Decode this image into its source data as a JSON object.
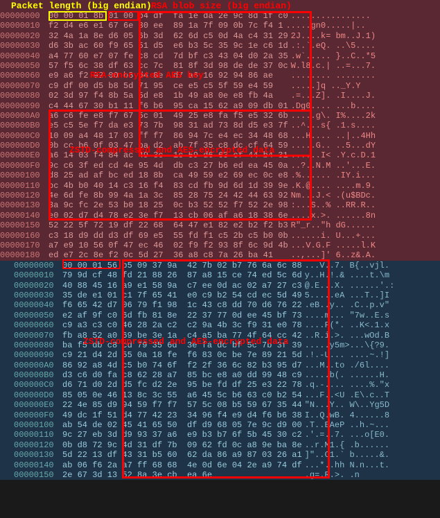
{
  "labels": {
    "packet_length": "Packet length (big endian)",
    "rsa_blob_size": "RSA blob size (big endian)",
    "rsa_encrypted_aes": "RSA-encrypted AES key",
    "zstd_aes_1": "ZSTD-compressed and AES-encrypted data",
    "zstd_aes_2": "ZSTD-compressed and AES-encrypted data"
  },
  "pink_rows": [
    {
      "offset": "00000000",
      "hex": "00 00 01 8b 01 00 b4 df  fa 1e da 2e 9c 8d 1f c0",
      "ascii": "................"
    },
    {
      "offset": "00000010",
      "hex": "f2 d4 e6 e1 67 6e 30 ee  89 1a 7f 09 0b 7c f4 1",
      "ascii": ".....gn0.....|.."
    },
    {
      "offset": "00000020",
      "hex": "32 4a 1a 8e d6 05 6b 3d  62 6d c5 0d 4a c4 31 29",
      "ascii": "2J....k= bm..J.1)"
    },
    {
      "offset": "00000030",
      "hex": "d6 3b ac 60 f9 65 51 d5  e6 b3 5c 35 9c 1e c6 1d",
      "ascii": ".:.`.eQ. ..\\5...."
    },
    {
      "offset": "00000040",
      "hex": "a4 77 60 e7 07 fe c8 cd  7d bf c3 43 04 d0 2a 35",
      "ascii": ".w`..... }..C..*5"
    },
    {
      "offset": "00000050",
      "hex": "57 f5 6c 38 df 63 cc 7c  81 8f 3d 98 de de 37 0c",
      "ascii": "W.l8.c.| ..=...7."
    },
    {
      "offset": "00000060",
      "hex": "e9 a6 f2 92 00 b8 d4 8e  d7 a6 16 92 94 86 ae   ",
      "ascii": "........ ........"
    },
    {
      "offset": "00000070",
      "hex": "c9 df 00 d5 b8 5d 71 95  ce e5 c5 5f 59 e4 59   ",
      "ascii": ".....]q .._Y.Y"
    },
    {
      "offset": "00000080",
      "hex": "02 3d 97 f4 8b 5a 5d e8  1b 49 a8 0e e8 fb 4a   ",
      "ascii": ".=...Z]. .I....J."
    },
    {
      "offset": "00000090",
      "hex": "c4 44 67 30 b1 11 f6 b6  95 ca 15 62 a9 09 db 01",
      "ascii": ".Dg0.... ...b...."
    },
    {
      "offset": "000000A0",
      "hex": "a6 c6 fe e8 f7 67 5c 01  49 25 e8 fa f5 e5 32 6b",
      "ascii": ".....g\\. I%....2k"
    },
    {
      "offset": "000000B0",
      "hex": "e5 c5 5e f7 da e3 73 7b  98 31 ad 73 8d d5 e3 7f",
      "ascii": "..^...s{ .1.s...."
    },
    {
      "offset": "000000C0",
      "hex": "10 09 a4 48 17 03 ff f7  86 94 7c e4 ec 34 48 68",
      "ascii": "...H.... ..|..4Hh"
    },
    {
      "offset": "000000D0",
      "hex": "0b cc b6 0f 03 47 ba d2  ab 7f 35 c8 dc cf 64 59",
      "ascii": ".....G.. ..5...dY"
    },
    {
      "offset": "000000E0",
      "hex": "a6 14 03 f4 84 ac 49 3c  1c 59 d6 63 cf 44 b4 31",
      "ascii": "......I< .Y.c.D.1"
    },
    {
      "offset": "000000F0",
      "hex": "9c c6 3f ed cd 4e 95 4d  db c3 27 b6 ed ea 45 0a",
      "ascii": "..?..N.M ..'...E."
    },
    {
      "offset": "00000100",
      "hex": "d8 25 ad af bc ed 18 8b  ca 49 59 e2 69 ec 0c e8",
      "ascii": ".%...... .IY.i..."
    },
    {
      "offset": "00000110",
      "hex": "bc 4b b0 40 14 c3 16 f4  83 cd fb 9d 6d 1d 39 9e",
      "ascii": ".K.@.... ....m.9."
    },
    {
      "offset": "00000120",
      "hex": "4e 6d fe 8b 99 4a 1a 3c  85 28 75 24 42 44 63 92",
      "ascii": "Nm...J.< .(u$BDc."
    },
    {
      "offset": "00000130",
      "hex": "3a 9c fc 2e 53 b0 18 25  0c b3 52 52 f7 52 2e 98",
      "ascii": ":...S..% ..RR.R.."
    },
    {
      "offset": "00000140",
      "hex": "e0 02 d7 d4 78 e2 3e f7  13 cb 06 af a6 18 38 6e",
      "ascii": "....x.>. ......8n"
    },
    {
      "offset": "00000150",
      "hex": "52 22 5f 72 19 df 22 68  64 47 e1 82 e2 b2 f2 b3",
      "ascii": "R\"_r..\"h dG......"
    },
    {
      "offset": "00000160",
      "hex": "c3 18 d9 dd d3 df 69 e5  55 fd f1 c5 2b c5 b0 0b",
      "ascii": "......i. U...+..."
    },
    {
      "offset": "00000170",
      "hex": "a7 e9 10 56 0f 47 ec 46  02 f9 f2 93 8f 6c 9d 4b",
      "ascii": "...V.G.F .....l.K"
    },
    {
      "offset": "00000180",
      "hex": "ed e7 2c 8e f2 0c 5d 27  36 a8 c8 7a 26 ba 41   ",
      "ascii": "..,...]' 6..z&.A."
    }
  ],
  "blue_rows": [
    {
      "offset": "00000000",
      "hex": "00 00 01 56 b5 09 37 9a  42 7b 02 b7 76 6a 6c 88",
      "ascii": "...V..7. B{..vjl."
    },
    {
      "offset": "00000010",
      "hex": "79 9d cf 48 fd 21 88 26  87 a8 15 ce 74 ed 5c 6d",
      "ascii": "y..H.!.& ....t.\\m"
    },
    {
      "offset": "00000020",
      "hex": "40 88 45 16 a9 e1 58 9a  c7 ee 0d ac 02 a7 27 c3",
      "ascii": "@.E...X. ......'.:"
    },
    {
      "offset": "00000030",
      "hex": "35 de e1 01 c1 7f 65 41  e0 c9 b2 54 cd ec 5d 49",
      "ascii": "5.....eA ...T..]I"
    },
    {
      "offset": "00000040",
      "hex": "f6 65 42 d7 06 79 f1 98  1c 43 c8 dd 70 d6 76 22",
      "ascii": ".eB..y.. .C..p.v\""
    },
    {
      "offset": "00000050",
      "hex": "e2 af 9f c0 6d fb 81 8e  22 37 77 0d ee 45 bf 73",
      "ascii": "....m... \"7w..E.s"
    },
    {
      "offset": "00000060",
      "hex": "c9 a3 c3 c0 46 28 2a c2  c2 9a 4b 3c f9 31 e0 78",
      "ascii": "....F(*. ..K<.1.x"
    },
    {
      "offset": "00000070",
      "hex": "fb a8 52 a0 69 be 3e 1a  c4 a5 ba 77 4f 64 cc 42",
      "ascii": "..R.i.>. ...wOd.B"
    },
    {
      "offset": "00000080",
      "hex": "ba f5 db c8 cd 79 35 6d  3e fa dc bf 5c 7b 3f 39",
      "ascii": ".....y5m>...\\{?9."
    },
    {
      "offset": "00000090",
      "hex": "c9 21 d4 2d 55 0a 18 fe  f6 83 0c be 7e 89 21 5d",
      "ascii": ".!.-U... ....~.!]"
    },
    {
      "offset": "000000A0",
      "hex": "86 92 a8 4d c5 b0 74 6f  f2 2f 36 6c 82 b3 95 d7",
      "ascii": "...M..to ./6l...."
    },
    {
      "offset": "000000B0",
      "hex": "d3 c6 d0 fa c8 62 28 a7  85 bc e8 a0 dd 99 48 c9",
      "ascii": ".....b(. ......H."
    },
    {
      "offset": "000000C0",
      "hex": "d6 71 d0 2d d5 fc d2 2e  95 be fd df 25 e3 22 78",
      "ascii": ".q.-.... ....%.\"x"
    },
    {
      "offset": "000000D0",
      "hex": "85 05 0e 46 13 8c 3c 55  a6 45 5c b6 63 c0 b2 54",
      "ascii": "...F..<U .E\\.c..T"
    },
    {
      "offset": "000000E0",
      "hex": "22 4e 85 d9 94 59 f7 f7  57 5c 08 b5 59 67 35 44",
      "ascii": "\"N...Y.. W\\..Yg5D"
    },
    {
      "offset": "000000F0",
      "hex": "49 dc 1f 51 d4 77 42 23  34 96 f4 e9 d4 f6 b6 38",
      "ascii": "I..Q.wB. 4......8"
    },
    {
      "offset": "00000100",
      "hex": "ab 54 de 02 45 41 65 50  df d9 68 05 7e 9c d9 00",
      "ascii": ".T..EAeP ..h.~..."
    },
    {
      "offset": "00000110",
      "hex": "9c 27 eb 3d d9 93 37 a6  e9 b3 b7 6f 5b 45 30 c2",
      "ascii": ".'.=..7. ...o[E0."
    },
    {
      "offset": "00000120",
      "hex": "0b d8 72 9c 4d 31 df 7b  09 62 fd 0c a8 9e ba 8e",
      "ascii": "..r.M1.{ .b......"
    },
    {
      "offset": "00000130",
      "hex": "5d 22 13 df 43 31 b5 60  62 da 86 a9 87 03 26 a1",
      "ascii": "]\"..C1.` b.....&."
    },
    {
      "offset": "00000140",
      "hex": "ab 06 f6 2a a7 ff 68 68  4e 0d 6e 04 2e a9 74 df",
      "ascii": "...*..hh N.n...t."
    },
    {
      "offset": "00000150",
      "hex": "2e 67 3d 13 52 8a 3e cb  ea 6e                  ",
      "ascii": ".g=.R.>. .n"
    }
  ]
}
